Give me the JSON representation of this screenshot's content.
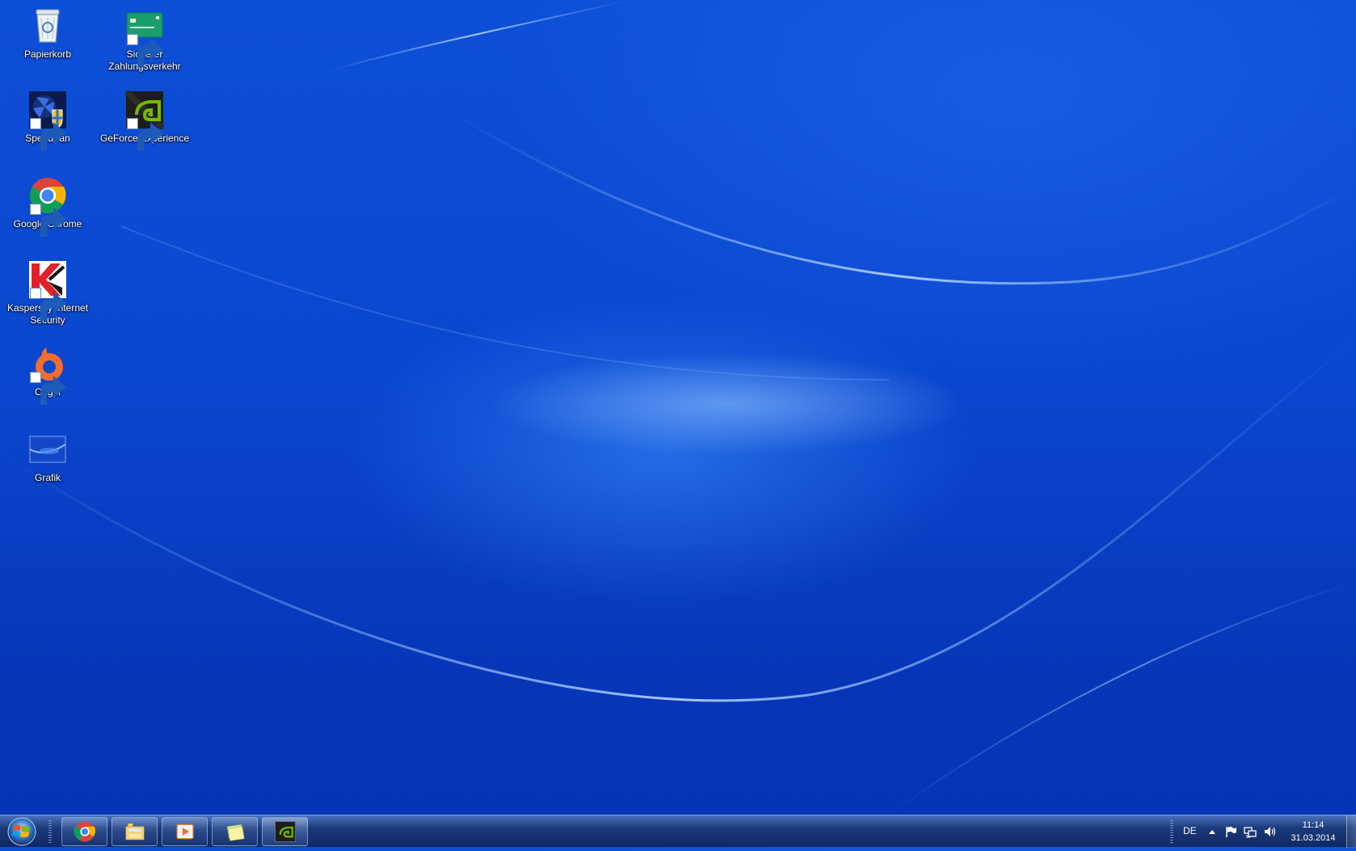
{
  "desktop": {
    "icons": [
      {
        "name": "Papierkorb",
        "icon": "recycle-bin-icon"
      },
      {
        "name": "Sicherer Zahlungsverkehr",
        "icon": "credit-card-icon"
      },
      {
        "name": "SpeedFan",
        "icon": "speedfan-icon"
      },
      {
        "name": "GeForce Experience",
        "icon": "nvidia-icon"
      },
      {
        "name": "Google Chrome",
        "icon": "chrome-icon"
      },
      {
        "name": "Kaspersky Internet Security",
        "icon": "kaspersky-icon"
      },
      {
        "name": "Origin",
        "icon": "origin-icon"
      },
      {
        "name": "Grafik",
        "icon": "image-file-icon"
      }
    ]
  },
  "taskbar": {
    "start_button": "windows-start-orb-icon",
    "pinned": [
      {
        "app": "Google Chrome",
        "icon": "chrome-icon"
      },
      {
        "app": "Windows Explorer",
        "icon": "file-explorer-icon"
      },
      {
        "app": "Windows Media Player",
        "icon": "media-player-icon"
      },
      {
        "app": "Sticky Notes",
        "icon": "sticky-notes-icon"
      },
      {
        "app": "GeForce Experience",
        "icon": "nvidia-icon",
        "active": true
      }
    ],
    "tray": {
      "language": "DE",
      "icons": [
        "show-hidden-icons-arrow-icon",
        "action-center-flag-icon",
        "network-icon",
        "volume-icon"
      ],
      "time": "11:14",
      "date": "31.03.2014"
    }
  }
}
